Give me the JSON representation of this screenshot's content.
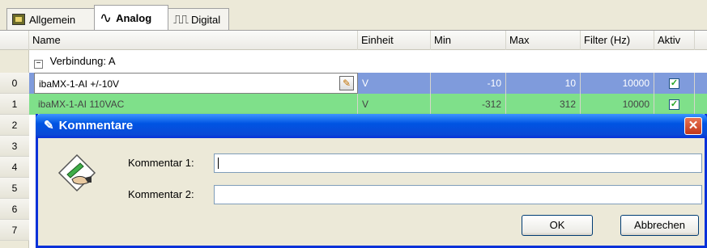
{
  "tabs": [
    {
      "label": "Allgemein",
      "icon": "module-chip-icon"
    },
    {
      "label": "Analog",
      "icon": "analog-wave-icon",
      "active": true
    },
    {
      "label": "Digital",
      "icon": "digital-signal-icon"
    }
  ],
  "grid": {
    "columns": [
      "Name",
      "Einheit",
      "Min",
      "Max",
      "Filter (Hz)",
      "Aktiv"
    ],
    "group_label": "Verbindung: A",
    "row_numbers": [
      "0",
      "1",
      "2",
      "3",
      "4",
      "5",
      "6",
      "7"
    ],
    "rows": [
      {
        "name": "ibaMX-1-AI +/-10V",
        "unit": "V",
        "min": "-10",
        "max": "10",
        "filter": "10000",
        "active": true
      },
      {
        "name": "ibaMX-1-AI 110VAC",
        "unit": "V",
        "min": "-312",
        "max": "312",
        "filter": "10000",
        "active": true
      }
    ]
  },
  "dialog": {
    "title": "Kommentare",
    "icon": "pen-writing-icon",
    "comment1_label": "Kommentar 1:",
    "comment1_value": "",
    "comment2_label": "Kommentar 2:",
    "comment2_value": "",
    "ok_label": "OK",
    "cancel_label": "Abbrechen"
  },
  "colors": {
    "selected_row": "#7f9bdc",
    "green_row": "#7fe08a",
    "titlebar": "#0054e3"
  }
}
